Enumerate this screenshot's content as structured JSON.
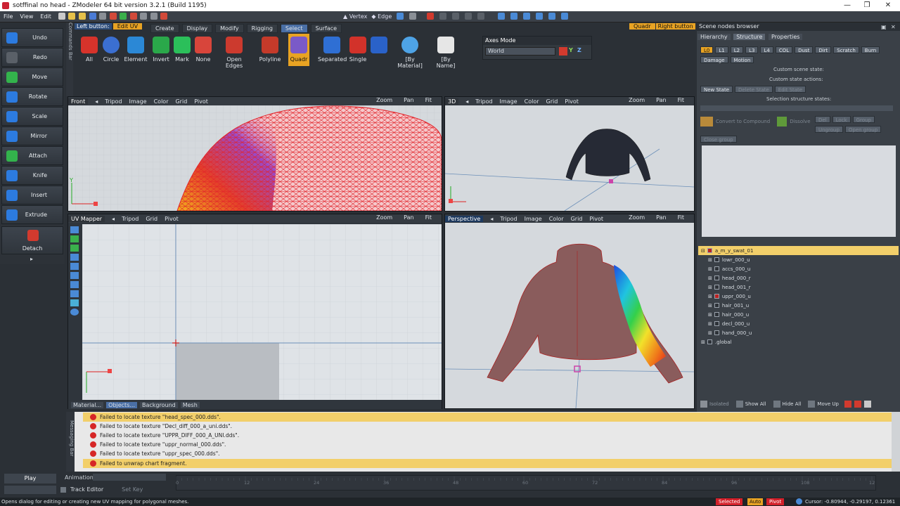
{
  "window": {
    "title": "sotffinal no head - ZModeler 64 bit version 3.2.1 (Build 1195)",
    "controls": [
      "—",
      "❐",
      "✕"
    ]
  },
  "menu": [
    "File",
    "View",
    "Edit"
  ],
  "left_button_label": "Left button:",
  "left_button_mode": "Edit UV",
  "top_tabs": [
    "Create",
    "Display",
    "Modify",
    "Rigging",
    "Select",
    "Surface"
  ],
  "top_tabs_active": "Select",
  "tools": [
    {
      "label": "All",
      "color": "#d6332b"
    },
    {
      "label": "Circle",
      "color": "#3b6fd1"
    },
    {
      "label": "Element",
      "color": "#2b88d6"
    },
    {
      "label": "Invert",
      "color": "#2aa84a"
    },
    {
      "label": "Mark",
      "color": "#2bbf5a"
    },
    {
      "label": "None",
      "color": "#d8453b"
    },
    {
      "label": "Open Edges",
      "color": "#cc3a2e"
    },
    {
      "label": "Polyline",
      "color": "#c43a2a"
    },
    {
      "label": "Quadr",
      "color": "#7a5ac8"
    },
    {
      "label": "Separated",
      "color": "#2f6fd4"
    },
    {
      "label": "Single",
      "color": "#d2322a"
    },
    {
      "label": "",
      "color": "#2a62c9"
    },
    {
      "label": "[By Material]",
      "color": "#4ea3e6"
    },
    {
      "label": "[By Name]",
      "color": "#e6e6e6"
    }
  ],
  "axes_mode": {
    "title": "Axes Mode",
    "value": "World",
    "x": "X",
    "y": "Y",
    "z": "Z"
  },
  "left_panel": [
    {
      "label": "Undo",
      "color": "#2c7be0"
    },
    {
      "label": "Redo",
      "color": "#5a6068"
    },
    {
      "label": "Move",
      "color": "#33b34c"
    },
    {
      "label": "Rotate",
      "color": "#2c7be0"
    },
    {
      "label": "Scale",
      "color": "#2c7be0"
    },
    {
      "label": "Mirror",
      "color": "#2c7be0"
    },
    {
      "label": "Attach",
      "color": "#33b34c"
    },
    {
      "label": "Knife",
      "color": "#2c7be0"
    },
    {
      "label": "Insert",
      "color": "#2c7be0"
    },
    {
      "label": "Extrude",
      "color": "#2c7be0"
    },
    {
      "label": "Detach",
      "color": "#d23a2e"
    }
  ],
  "commands_bar": "Commands Bar",
  "messaging_bar": "Messaging Bar",
  "viewports": {
    "front": {
      "name": "Front",
      "items": [
        "Tripod",
        "Image",
        "Color",
        "Grid",
        "Pivot"
      ],
      "right": [
        "Zoom",
        "Pan",
        "Fit"
      ]
    },
    "threed": {
      "name": "3D",
      "items": [
        "Tripod",
        "Image",
        "Color",
        "Grid",
        "Pivot"
      ],
      "right": [
        "Zoom",
        "Pan",
        "Fit"
      ]
    },
    "uv": {
      "name": "UV Mapper",
      "items": [
        "Tripod",
        "Grid",
        "Pivot"
      ],
      "right": [
        "Zoom",
        "Pan",
        "Fit"
      ]
    },
    "persp": {
      "name": "Perspective",
      "items": [
        "Tripod",
        "Image",
        "Color",
        "Grid",
        "Pivot"
      ],
      "right": [
        "Zoom",
        "Pan",
        "Fit"
      ]
    }
  },
  "uv_bottom_tabs": [
    "Material...",
    "Objects...",
    "Background",
    "Mesh"
  ],
  "axis_y": "Y",
  "scene": {
    "title": "Scene nodes browser",
    "quadr_label": "Quadr",
    "right_button": "Right button",
    "tabs": [
      "Hierarchy",
      "Structure",
      "Properties"
    ],
    "tab_active": "Structure",
    "lod_buttons": [
      "L0",
      "L1",
      "L2",
      "L3",
      "L4",
      "COL",
      "Dust",
      "Dirt",
      "Scratch",
      "Burn"
    ],
    "damage": "Damage",
    "motion": "Motion",
    "custom_scene_state": "Custom scene state:",
    "custom_state_actions": "Custom state actions:",
    "new_state": "New State",
    "delete_state": "Delete State",
    "edit_state": "Edit State",
    "selection_states": "Selection structure states:",
    "convert": "Convert to Compound",
    "dissolve": "Dissolve",
    "small_btns": [
      "Del",
      "Lock",
      "Group"
    ],
    "ungroup": "Ungroup",
    "open_group": "Open group",
    "close_group": "Close group",
    "tree": [
      {
        "label": "a_m_y_swat_01",
        "level": 0,
        "box": "red"
      },
      {
        "label": "lowr_000_u",
        "level": 1,
        "box": ""
      },
      {
        "label": "accs_000_u",
        "level": 1,
        "box": ""
      },
      {
        "label": "head_000_r",
        "level": 1,
        "box": ""
      },
      {
        "label": "head_001_r",
        "level": 1,
        "box": ""
      },
      {
        "label": "uppr_000_u",
        "level": 1,
        "box": "red"
      },
      {
        "label": "hair_001_u",
        "level": 1,
        "box": ""
      },
      {
        "label": "hair_000_u",
        "level": 1,
        "box": ""
      },
      {
        "label": "decl_000_u",
        "level": 1,
        "box": ""
      },
      {
        "label": "hand_000_u",
        "level": 1,
        "box": ""
      },
      {
        "label": ".global",
        "level": 0,
        "box": ""
      }
    ],
    "bottom": [
      "Isolated",
      "Show All",
      "Hide All",
      "Move Up"
    ]
  },
  "messages": [
    {
      "text": "Failed to locate texture \"head_spec_000.dds\".",
      "hl": true
    },
    {
      "text": "Failed to locate texture \"Decl_diff_000_a_uni.dds\".",
      "hl": false
    },
    {
      "text": "Failed to locate texture \"UPPR_DIFF_000_A_UNI.dds\".",
      "hl": false
    },
    {
      "text": "Failed to locate texture \"uppr_normal_000.dds\".",
      "hl": false
    },
    {
      "text": "Failed to locate texture \"uppr_spec_000.dds\".",
      "hl": false
    },
    {
      "text": "Failed to unwrap chart fragment.",
      "hl": true
    }
  ],
  "anim": {
    "play": "Play",
    "animation": "Animation:",
    "track_editor": "Track Editor",
    "set_key": "Set Key",
    "ticks": [
      "0",
      "12",
      "24",
      "36",
      "48",
      "60",
      "72",
      "84",
      "96",
      "108",
      "12"
    ]
  },
  "status": {
    "text": "Opens dialog for editing or creating new UV mapping for polygonal meshes.",
    "selected": "Selected",
    "auto": "Auto",
    "pivot": "Pivot",
    "cursor": "Cursor: -0.80944, -0.29197, 0.12361"
  }
}
